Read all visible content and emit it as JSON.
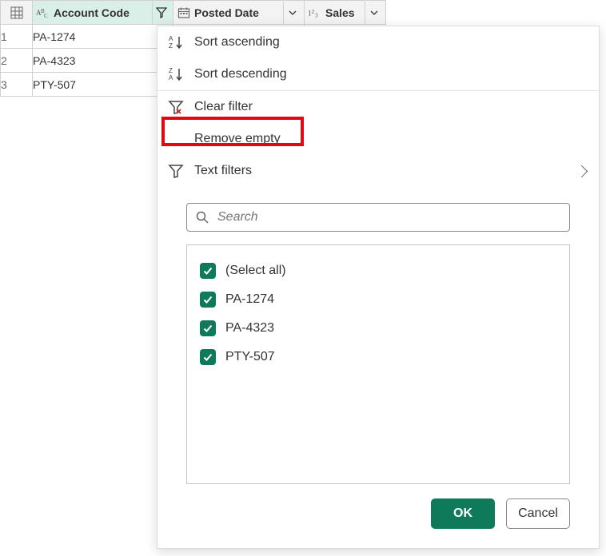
{
  "columns": {
    "account_code": {
      "label": "Account Code"
    },
    "posted_date": {
      "label": "Posted Date"
    },
    "sales": {
      "label": "Sales"
    }
  },
  "rows": [
    {
      "n": "1",
      "account_code": "PA-1274"
    },
    {
      "n": "2",
      "account_code": "PA-4323"
    },
    {
      "n": "3",
      "account_code": "PTY-507"
    }
  ],
  "menu": {
    "sort_asc": "Sort ascending",
    "sort_desc": "Sort descending",
    "clear_filter": "Clear filter",
    "remove_empty": "Remove empty",
    "text_filters": "Text filters"
  },
  "search": {
    "placeholder": "Search"
  },
  "filter_values": {
    "select_all": "(Select all)",
    "items": [
      "PA-1274",
      "PA-4323",
      "PTY-507"
    ]
  },
  "buttons": {
    "ok": "OK",
    "cancel": "Cancel"
  },
  "colors": {
    "accent": "#0f7a5a",
    "highlight": "#e30613"
  }
}
